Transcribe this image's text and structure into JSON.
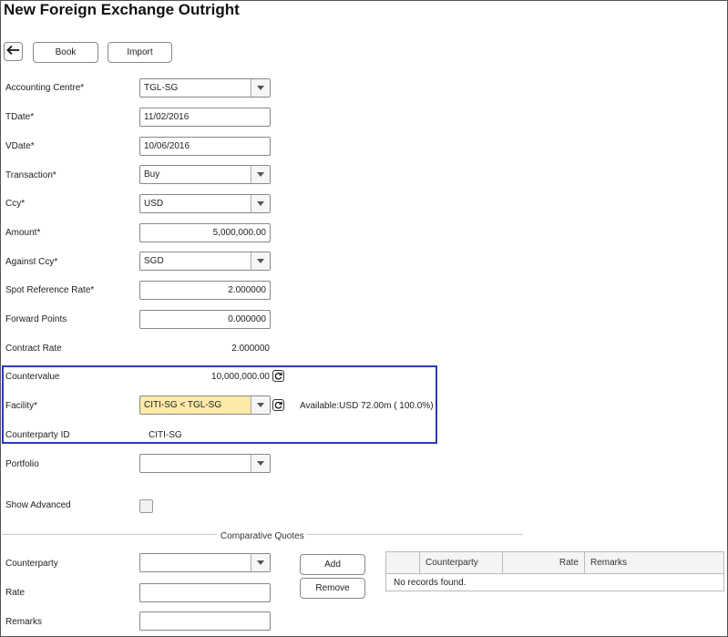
{
  "title": "New Foreign Exchange Outright",
  "toolbar": {
    "book_label": "Book",
    "import_label": "Import"
  },
  "form": {
    "accounting_centre": {
      "label": "Accounting Centre*",
      "value": "TGL-SG"
    },
    "tdate": {
      "label": "TDate*",
      "value": "11/02/2016"
    },
    "vdate": {
      "label": "VDate*",
      "value": "10/06/2016"
    },
    "transaction": {
      "label": "Transaction*",
      "value": "Buy"
    },
    "ccy": {
      "label": "Ccy*",
      "value": "USD"
    },
    "amount": {
      "label": "Amount*",
      "value": "5,000,000.00"
    },
    "against_ccy": {
      "label": "Against Ccy*",
      "value": "SGD"
    },
    "spot_rate": {
      "label": "Spot Reference Rate*",
      "value": "2.000000"
    },
    "forward_points": {
      "label": "Forward Points",
      "value": "0.000000"
    },
    "contract_rate": {
      "label": "Contract Rate",
      "value": "2.000000"
    },
    "countervalue": {
      "label": "Countervalue",
      "value": "10,000,000.00"
    },
    "facility": {
      "label": "Facility*",
      "value": "CITI-SG < TGL-SG",
      "available": "Available:USD 72.00m ( 100.0%)"
    },
    "counterparty_id": {
      "label": "Counterparty ID",
      "value": "CITI-SG"
    },
    "portfolio": {
      "label": "Portfolio",
      "value": ""
    },
    "show_advanced": {
      "label": "Show Advanced"
    }
  },
  "quotes": {
    "section_title": "Comparative Quotes",
    "counterparty_label": "Counterparty",
    "rate_label": "Rate",
    "remarks_label": "Remarks",
    "add_label": "Add",
    "remove_label": "Remove",
    "grid": {
      "columns": [
        "",
        "Counterparty",
        "Rate",
        "Remarks"
      ],
      "empty_text": "No records found."
    }
  },
  "colors": {
    "highlight_border": "#2b3bb5",
    "facility_fill": "#fde9a8"
  },
  "icons": {
    "back": "arrow-left-icon",
    "refresh": "refresh-icon",
    "dropdown": "chevron-down-icon"
  }
}
